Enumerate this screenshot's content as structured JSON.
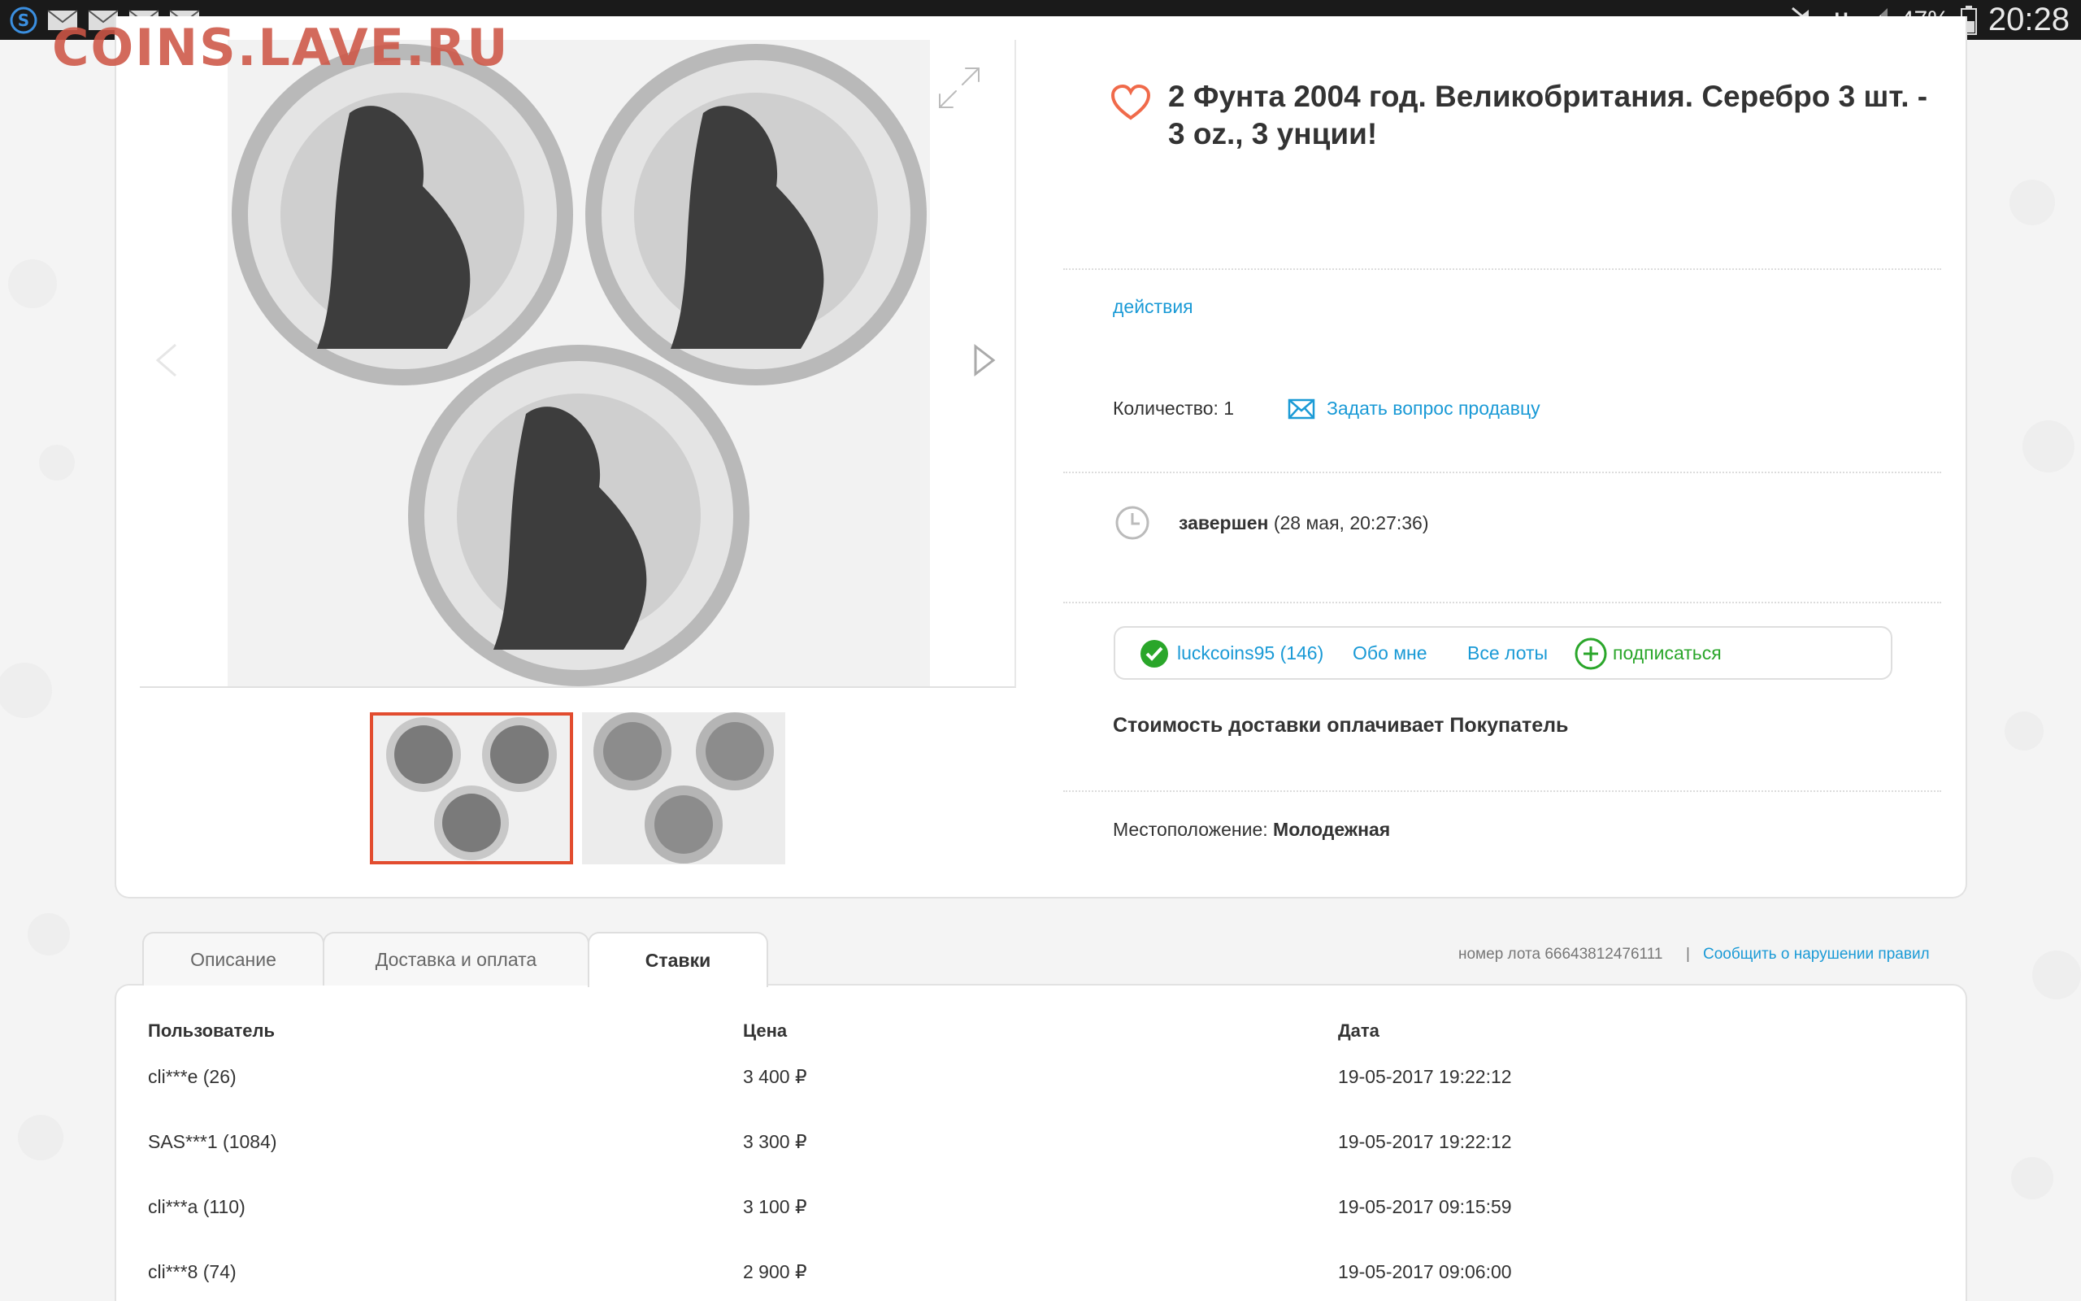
{
  "status_bar": {
    "battery": "47%",
    "time": "20:28",
    "network": "H"
  },
  "watermark": "COINS.LAVE.RU",
  "lot": {
    "title": "2 Фунта 2004 год. Великобритания. Серебро 3 шт. - 3 oz., 3 унции!",
    "actions_label": "действия",
    "quantity": "Количество: 1",
    "ask_seller": "Задать вопрос продавцу",
    "status_bold": "завершен",
    "status_detail": " (28 мая, 20:27:36)",
    "seller": {
      "name": "luckcoins95 (146)",
      "about": "Обо мне",
      "all_lots": "Все лоты",
      "subscribe": "подписаться"
    },
    "shipping_note": "Стоимость доставки оплачивает Покупатель",
    "location_label": "Местоположение: ",
    "location_value": "Молодежная"
  },
  "tabs": [
    {
      "label": "Описание"
    },
    {
      "label": "Доставка и оплата"
    },
    {
      "label": "Ставки"
    }
  ],
  "lot_number": "номер лота 66643812476111",
  "separator": "|",
  "report_link": "Сообщить о нарушении правил",
  "bids": {
    "headers": [
      "Пользователь",
      "Цена",
      "Дата"
    ],
    "rows": [
      {
        "user": "cli***e (26)",
        "price": "3 400 ₽",
        "date": "19-05-2017 19:22:12"
      },
      {
        "user": "SAS***1 (1084)",
        "price": "3 300 ₽",
        "date": "19-05-2017 19:22:12"
      },
      {
        "user": "cli***a (110)",
        "price": "3 100 ₽",
        "date": "19-05-2017 09:15:59"
      },
      {
        "user": "cli***8 (74)",
        "price": "2 900 ₽",
        "date": "19-05-2017 09:06:00"
      }
    ]
  },
  "colors": {
    "link": "#1a9ad6",
    "subscribe": "#2aa62a",
    "accent": "#e24c2f"
  }
}
